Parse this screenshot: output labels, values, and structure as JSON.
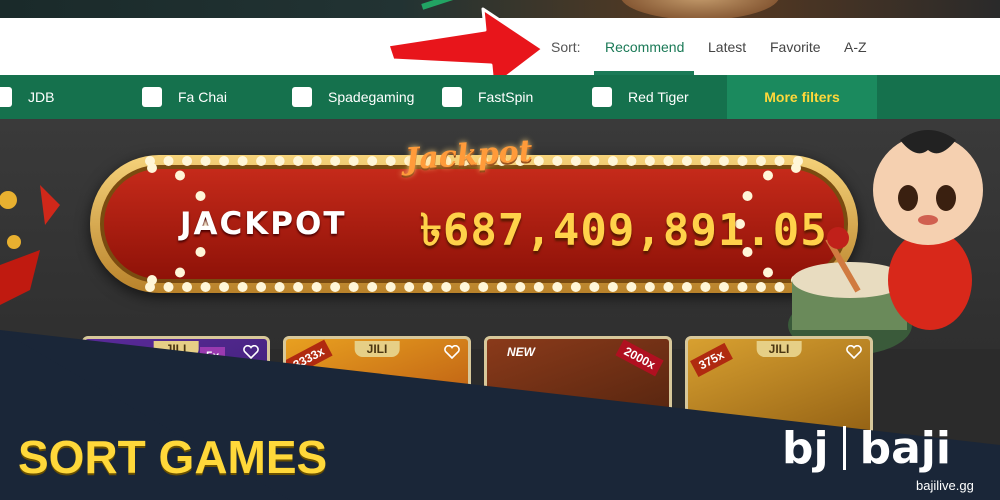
{
  "sort_bar": {
    "label": "Sort:",
    "options": [
      {
        "label": "Recommend",
        "active": true
      },
      {
        "label": "Latest",
        "active": false
      },
      {
        "label": "Favorite",
        "active": false
      },
      {
        "label": "A-Z",
        "active": false
      }
    ]
  },
  "filters": {
    "providers": [
      "JDB",
      "Fa Chai",
      "Spadegaming",
      "FastSpin",
      "Red Tiger"
    ],
    "more_label": "More filters"
  },
  "jackpot": {
    "logo": "Jackpot",
    "label": "JACKPOT",
    "amount": "৳687,409,891.05"
  },
  "games": [
    {
      "provider": "JILI",
      "badge": "5x"
    },
    {
      "provider": "JILI",
      "badge": "3333x"
    },
    {
      "provider": "",
      "badge": "NEW",
      "badge2": "2000x"
    },
    {
      "provider": "JILI",
      "badge": "375x"
    }
  ],
  "overlay": {
    "headline": "SORT GAMES",
    "brand_short": "bj",
    "brand_name": "baji",
    "brand_url": "bajilive.gg"
  },
  "colors": {
    "accent_green": "#1b7a57",
    "filter_bar": "#15714d",
    "more_filters_text": "#ffd83a",
    "headline": "#ffd83a",
    "arrow": "#e8151b",
    "overlay_bg": "#1a2638"
  },
  "icons": [
    "red-arrow-icon",
    "checkbox-icon",
    "heart-icon"
  ]
}
